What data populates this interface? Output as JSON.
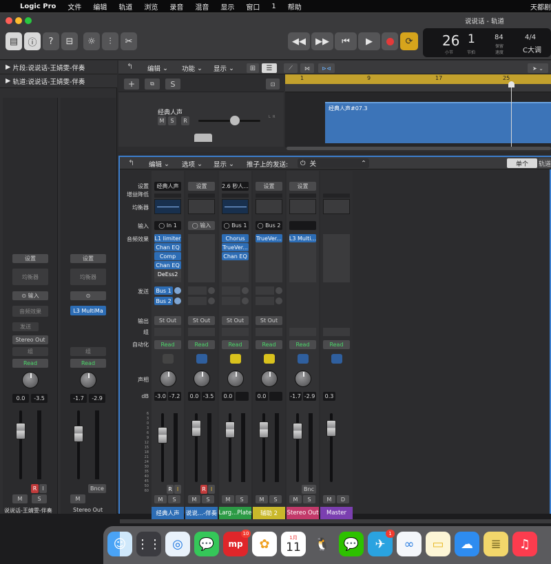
{
  "menubar": {
    "items": [
      "Logic Pro",
      "文件",
      "编辑",
      "轨道",
      "浏览",
      "录音",
      "混音",
      "显示",
      "窗口",
      "1",
      "帮助"
    ],
    "right": "天都剧"
  },
  "window": {
    "title": "说说话 - 轨道"
  },
  "lcd": {
    "bar": "26",
    "beat": "1",
    "bar_label": "小节",
    "beat_label": "节拍",
    "tempo": "84",
    "tempo_label": "保留",
    "tempo_sub": "速度",
    "sig": "4/4",
    "key": "C大调"
  },
  "inspector": {
    "region": "片段:说说话-王婧雯-伴奏",
    "track": "轨道:说说话-王婧雯-伴奏",
    "left": {
      "settings": "设置",
      "eq": "均衡器",
      "input": "输入",
      "fx": "音频效果",
      "send": "发送",
      "output": "Stereo Out",
      "group": "组",
      "auto": "Read",
      "vol": "0.0",
      "peak": "-3.5",
      "r": "R",
      "i": "I",
      "m": "M",
      "s": "S",
      "name": "说说话-王婧雯-伴奏"
    },
    "right": {
      "settings": "设置",
      "eq": "均衡器",
      "fx": "L3 MultiMa",
      "group": "组",
      "auto": "Read",
      "vol": "-1.7",
      "peak": "-2.9",
      "bnce": "Bnce",
      "m": "M",
      "name": "Stereo Out"
    }
  },
  "tracks": {
    "edit": "编辑",
    "func": "功能",
    "view": "显示",
    "track_name": "经典人声",
    "region_name": "经典人声#07.3",
    "m": "M",
    "s": "S",
    "r": "R",
    "ruler": [
      "1",
      "9",
      "17",
      "25"
    ]
  },
  "mixer": {
    "edit": "编辑",
    "options": "选项",
    "view": "显示",
    "sends_on_faders": "推子上的发送:",
    "off": "关",
    "single": "单个",
    "tracks_tab": "轨道",
    "labels": {
      "settings": "设置",
      "gain": "增益降低",
      "eq": "均衡器",
      "input": "输入",
      "fx": "音频效果",
      "sends": "发送",
      "output": "输出",
      "group": "组",
      "auto": "自动化",
      "pan": "声相",
      "db": "dB"
    },
    "strips": [
      {
        "name": "经典人声",
        "color": "#2d6db5",
        "setting": "经典人声",
        "input": "In 1",
        "fx": [
          "L1 limiter",
          "Chan EQ",
          "Comp",
          "Chan EQ",
          "DeEss2"
        ],
        "sends": [
          "Bus 1",
          "Bus 2"
        ],
        "out": "St Out",
        "auto": "Read",
        "vol": "-3.0",
        "peak": "-7.2",
        "ri": [
          "R",
          "I"
        ],
        "ms": [
          "M",
          "S"
        ]
      },
      {
        "name": "说说...-伴奏",
        "color": "#2d6db5",
        "setting": "设置",
        "input": "输入",
        "fx": [],
        "sends": [],
        "out": "St Out",
        "auto": "Read",
        "vol": "0.0",
        "peak": "-3.5",
        "ri": [
          "R",
          "I"
        ],
        "ms": [
          "M",
          "S"
        ]
      },
      {
        "name": "Larg...Plate",
        "color": "#2c9a45",
        "setting": "2.6 秒人...",
        "input": "Bus 1",
        "fx": [
          "Chorus",
          "TrueVer...",
          "Chan EQ"
        ],
        "sends": [],
        "out": "St Out",
        "auto": "Read",
        "vol": "0.0",
        "peak": "",
        "ri": [],
        "ms": [
          "M",
          "S"
        ]
      },
      {
        "name": "辅助 2",
        "color": "#c9b82b",
        "setting": "设置",
        "input": "Bus 2",
        "fx": [
          "TrueVer..."
        ],
        "sends": [],
        "out": "St Out",
        "auto": "Read",
        "vol": "0.0",
        "peak": "",
        "ri": [],
        "ms": [
          "M",
          "S"
        ]
      },
      {
        "name": "Stereo Out",
        "color": "#c23a6a",
        "setting": "设置",
        "input": "",
        "fx": [
          "L3 Multi..."
        ],
        "sends": [],
        "out": "",
        "auto": "Read",
        "vol": "-1.7",
        "peak": "-2.9",
        "ri": [
          "Bnc"
        ],
        "ms": [
          "M",
          "S"
        ]
      },
      {
        "name": "Master",
        "color": "#7b3fb0",
        "setting": "",
        "input": "",
        "fx": [],
        "sends": [],
        "out": "",
        "auto": "Read",
        "vol": "0.3",
        "peak": "",
        "ri": [],
        "ms": [
          "M",
          "D"
        ]
      }
    ],
    "scale": [
      "6",
      "3",
      "0",
      "3",
      "6",
      "9",
      "12",
      "15",
      "18",
      "21",
      "24",
      "30",
      "35",
      "40",
      "45",
      "50",
      "60"
    ]
  },
  "dock": {
    "calendar_month": "1月",
    "calendar_day": "11",
    "badge_weibo": "10",
    "badge_telegram": "1"
  }
}
